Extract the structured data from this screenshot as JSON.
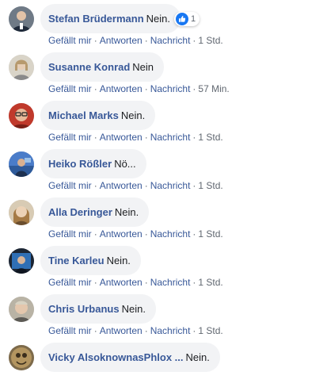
{
  "actions": {
    "like": "Gefällt mir",
    "reply": "Antworten",
    "message": "Nachricht",
    "separator": "·"
  },
  "colors": {
    "author": "#385898",
    "bubble": "#f2f3f5",
    "meta": "#606770",
    "like_badge": "#1877f2"
  },
  "comments": [
    {
      "author": "Stefan Brüdermann",
      "text": "Nein.",
      "time": "1 Std.",
      "reactions": {
        "icon": "like-icon",
        "count": "1"
      }
    },
    {
      "author": "Susanne Konrad",
      "text": "Nein",
      "time": "57 Min."
    },
    {
      "author": "Michael Marks",
      "text": "Nein.",
      "time": "1 Std."
    },
    {
      "author": "Heiko Rößler",
      "text": "Nö...",
      "time": "1 Std."
    },
    {
      "author": "Alla Deringer",
      "text": "Nein.",
      "time": "1 Std."
    },
    {
      "author": "Tine Karleu",
      "text": "Nein.",
      "time": "1 Std."
    },
    {
      "author": "Chris Urbanus",
      "text": "Nein.",
      "time": "1 Std."
    },
    {
      "author": "Vicky AlsoknownasPhlox ...",
      "text": "Nein."
    }
  ]
}
